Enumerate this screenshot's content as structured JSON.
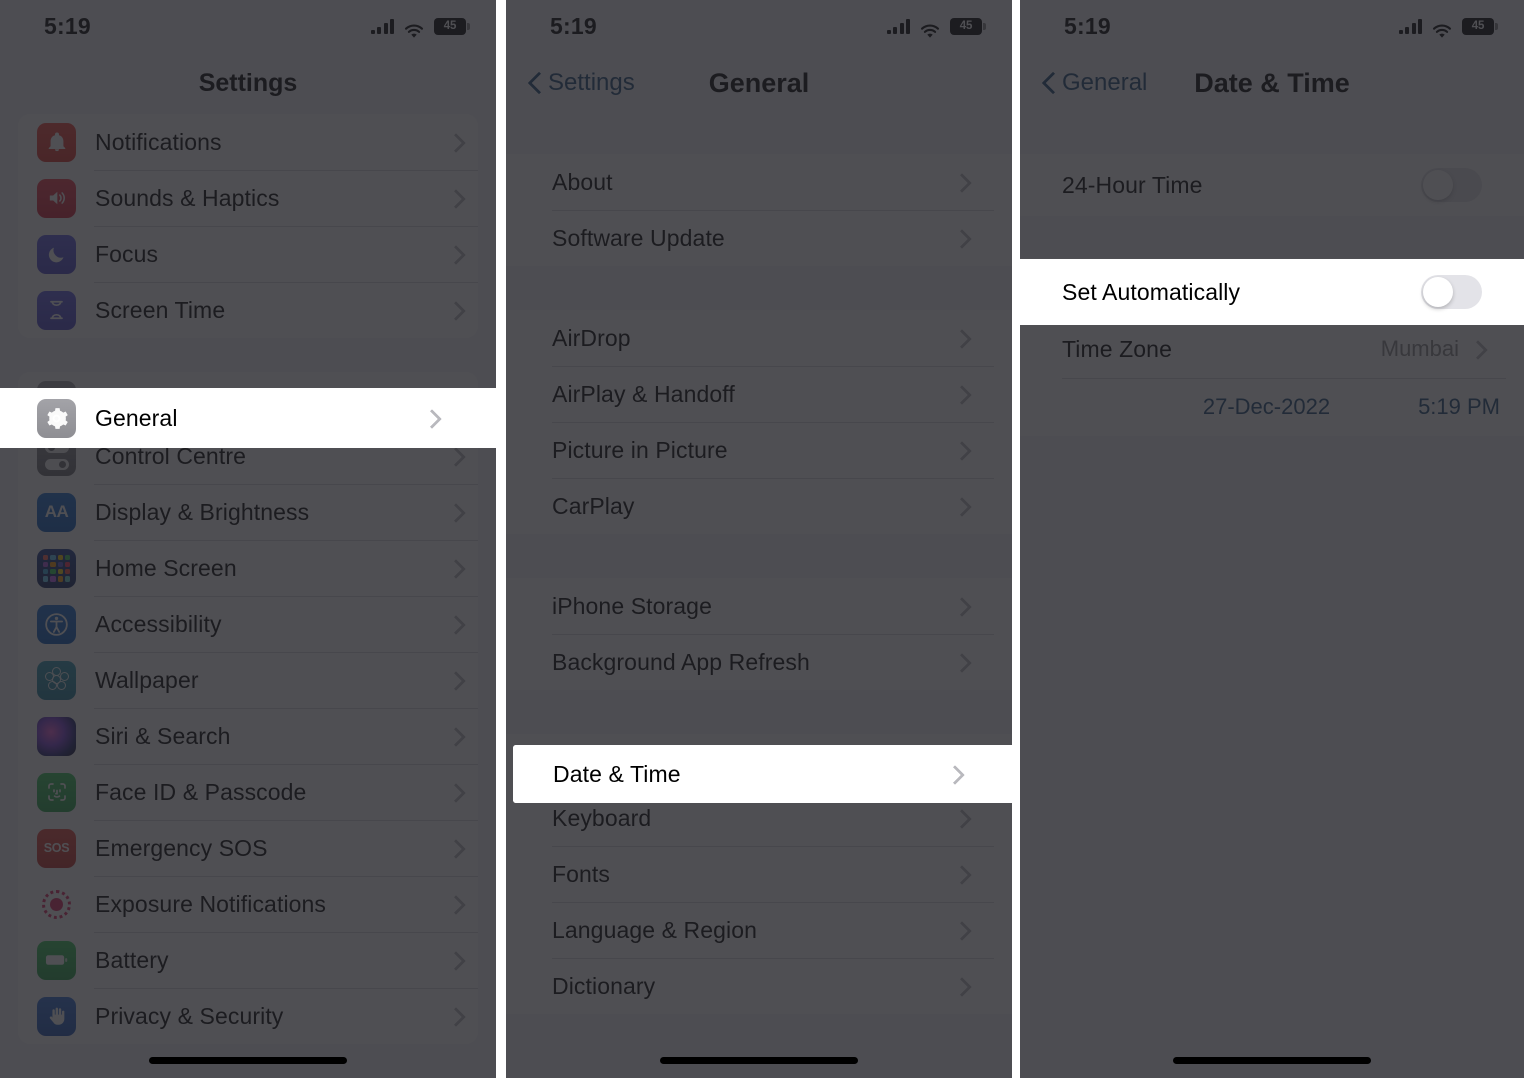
{
  "status_bar": {
    "time": "5:19",
    "signal_icon": "cellular-bars-icon",
    "wifi_icon": "wifi-icon",
    "battery_level": "45",
    "battery_icon": "battery-icon"
  },
  "panel1": {
    "nav": {
      "title": "Settings"
    },
    "groups": [
      {
        "rows": [
          {
            "icon": "bell-icon",
            "icon_class": "ic-notifications",
            "glyph": "▲",
            "label": "Notifications",
            "accessory": "chevron-right-icon"
          },
          {
            "icon": "speaker-wave-icon",
            "icon_class": "ic-sounds",
            "glyph": "▲",
            "label": "Sounds & Haptics",
            "accessory": "chevron-right-icon"
          },
          {
            "icon": "moon-icon",
            "icon_class": "ic-focus",
            "glyph": "☽",
            "label": "Focus",
            "accessory": "chevron-right-icon"
          },
          {
            "icon": "hourglass-icon",
            "icon_class": "ic-screentime",
            "glyph": "⧖",
            "label": "Screen Time",
            "accessory": "chevron-right-icon"
          }
        ]
      },
      {
        "rows": [
          {
            "icon": "gear-icon",
            "icon_class": "ic-general",
            "glyph": "⚙",
            "label": "General",
            "accessory": "chevron-right-icon",
            "highlighted": true
          },
          {
            "icon": "control-centre-icon",
            "icon_class": "ic-control",
            "glyph": "",
            "label": "Control Centre",
            "accessory": "chevron-right-icon"
          },
          {
            "icon": "text-size-icon",
            "icon_class": "ic-display",
            "glyph": "AA",
            "label": "Display & Brightness",
            "accessory": "chevron-right-icon"
          },
          {
            "icon": "home-screen-icon",
            "icon_class": "ic-home",
            "glyph": "",
            "label": "Home Screen",
            "accessory": "chevron-right-icon"
          },
          {
            "icon": "accessibility-icon",
            "icon_class": "ic-access",
            "glyph": "♿",
            "label": "Accessibility",
            "accessory": "chevron-right-icon"
          },
          {
            "icon": "wallpaper-icon",
            "icon_class": "ic-wallpaper",
            "glyph": "",
            "label": "Wallpaper",
            "accessory": "chevron-right-icon"
          },
          {
            "icon": "siri-icon",
            "icon_class": "ic-siri",
            "glyph": "",
            "label": "Siri & Search",
            "accessory": "chevron-right-icon"
          },
          {
            "icon": "face-id-icon",
            "icon_class": "ic-faceid",
            "glyph": "☺",
            "label": "Face ID & Passcode",
            "accessory": "chevron-right-icon"
          },
          {
            "icon": "sos-icon",
            "icon_class": "ic-sos",
            "glyph": "SOS",
            "label": "Emergency SOS",
            "accessory": "chevron-right-icon"
          },
          {
            "icon": "exposure-icon",
            "icon_class": "ic-exposure",
            "glyph": "",
            "label": "Exposure Notifications",
            "accessory": "chevron-right-icon"
          },
          {
            "icon": "battery-icon",
            "icon_class": "ic-battery",
            "glyph": "▬",
            "label": "Battery",
            "accessory": "chevron-right-icon"
          },
          {
            "icon": "hand-icon",
            "icon_class": "ic-privacy",
            "glyph": "✋",
            "label": "Privacy & Security",
            "accessory": "chevron-right-icon"
          }
        ]
      }
    ]
  },
  "panel2": {
    "nav": {
      "back_label": "Settings",
      "title": "General",
      "back_icon": "chevron-left-icon"
    },
    "groups": [
      {
        "rows": [
          {
            "label": "About",
            "accessory": "chevron-right-icon"
          },
          {
            "label": "Software Update",
            "accessory": "chevron-right-icon"
          }
        ]
      },
      {
        "rows": [
          {
            "label": "AirDrop",
            "accessory": "chevron-right-icon"
          },
          {
            "label": "AirPlay & Handoff",
            "accessory": "chevron-right-icon"
          },
          {
            "label": "Picture in Picture",
            "accessory": "chevron-right-icon"
          },
          {
            "label": "CarPlay",
            "accessory": "chevron-right-icon"
          }
        ]
      },
      {
        "rows": [
          {
            "label": "iPhone Storage",
            "accessory": "chevron-right-icon"
          },
          {
            "label": "Background App Refresh",
            "accessory": "chevron-right-icon"
          }
        ]
      },
      {
        "rows": [
          {
            "label": "Date & Time",
            "accessory": "chevron-right-icon",
            "highlighted": true
          },
          {
            "label": "Keyboard",
            "accessory": "chevron-right-icon"
          },
          {
            "label": "Fonts",
            "accessory": "chevron-right-icon"
          },
          {
            "label": "Language & Region",
            "accessory": "chevron-right-icon"
          },
          {
            "label": "Dictionary",
            "accessory": "chevron-right-icon"
          }
        ]
      }
    ]
  },
  "panel3": {
    "nav": {
      "back_label": "General",
      "title": "Date & Time",
      "back_icon": "chevron-left-icon"
    },
    "groups": [
      {
        "rows": [
          {
            "label": "24-Hour Time",
            "accessory": "toggle",
            "toggle_on": false
          }
        ]
      },
      {
        "rows": [
          {
            "label": "Set Automatically",
            "accessory": "toggle",
            "toggle_on": false,
            "highlighted": true
          },
          {
            "label": "Time Zone",
            "value": "Mumbai",
            "accessory": "chevron-right-icon"
          },
          {
            "date": "27-Dec-2022",
            "time": "5:19 PM",
            "accessory": "date-time-link"
          }
        ]
      }
    ]
  },
  "colors": {
    "accent_blue": "#1f4e79",
    "dim_overlay": "rgba(35,35,40,0.80)",
    "list_bg": "#f2f2f7",
    "row_bg": "#ffffff",
    "separator": "#d6d6da",
    "secondary_text": "#8a8a8e"
  }
}
